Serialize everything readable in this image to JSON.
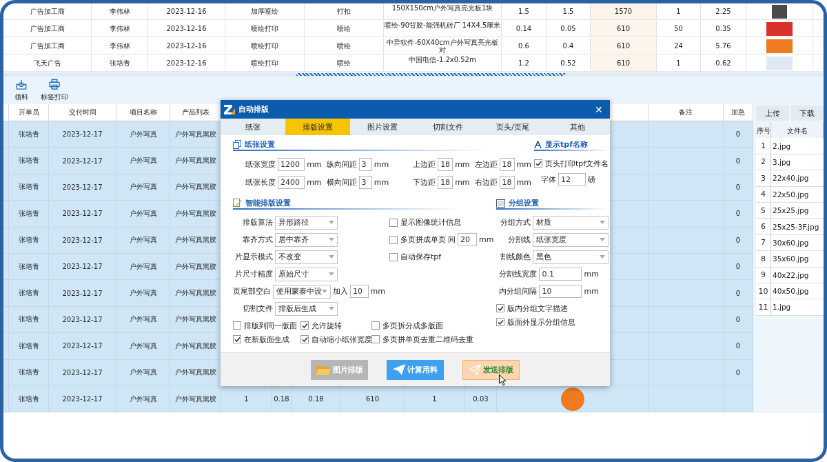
{
  "top_table": {
    "rows": [
      {
        "cells": [
          "广告加工商",
          "李伟林",
          "2023-12-16",
          "加厚喷绘",
          "打扣",
          "150X150cm户外写真亮光板1块",
          "1.5",
          "1.5",
          "1570",
          "1",
          "2.25"
        ],
        "thumbnail": true
      },
      {
        "cells": [
          "广告加工商",
          "李伟林",
          "2023-12-16",
          "喷绘打印",
          "喷绘",
          "喷绘-90背胶-能强机砖厂 14X4.5厘米",
          "0.14",
          "0.05",
          "610",
          "50",
          "0.35"
        ],
        "thumbnail": true
      },
      {
        "cells": [
          "广告加工商",
          "李伟林",
          "2023-12-16",
          "喷绘打印",
          "喷绘",
          "中异软件-60X40cm户外写真亮光板对",
          "0.6",
          "0.4",
          "610",
          "24",
          "5.76"
        ],
        "thumbnail": true
      },
      {
        "cells": [
          "飞天广告",
          "张培青",
          "2023-12-16",
          "喷绘打印",
          "喷绘",
          "中国电信-1.2x0.52m",
          "1.2",
          "0.52",
          "610",
          "1",
          "0.62"
        ],
        "thumbnail": true
      }
    ]
  },
  "toolbar": [
    {
      "label": "领料"
    },
    {
      "label": "标签打印"
    }
  ],
  "orders_table": {
    "columns": [
      "开单员",
      "交付时间",
      "项目名称",
      "产品列表"
    ],
    "trailing_columns": [
      "备注",
      "加急"
    ],
    "rows": [
      {
        "selected": true,
        "cells": [
          "张培青",
          "2023-12-17",
          "户外写真",
          "户外写真黑胶"
        ],
        "urgent": "0"
      },
      {
        "selected": true,
        "cells": [
          "张培青",
          "2023-12-17",
          "户外写真",
          "户外写真黑胶"
        ],
        "urgent": "0"
      },
      {
        "selected": true,
        "cells": [
          "张培青",
          "2023-12-17",
          "户外写真",
          "户外写真黑胶"
        ],
        "urgent": "0"
      },
      {
        "selected": true,
        "cells": [
          "张培青",
          "2023-12-17",
          "户外写真",
          "户外写真黑胶"
        ],
        "urgent": "0"
      },
      {
        "selected": true,
        "cells": [
          "张培青",
          "2023-12-17",
          "户外写真",
          "户外写真黑胶"
        ],
        "urgent": "0"
      },
      {
        "selected": true,
        "cells": [
          "张培青",
          "2023-12-17",
          "户外写真",
          "户外写真黑胶"
        ],
        "urgent": "0"
      },
      {
        "selected": true,
        "cells": [
          "张培青",
          "2023-12-17",
          "户外写真",
          "户外写真黑胶"
        ],
        "urgent": "0"
      },
      {
        "selected": true,
        "cells": [
          "张培青",
          "2023-12-17",
          "户外写真",
          "户外写真黑胶"
        ],
        "urgent": "0"
      },
      {
        "selected": true,
        "cells": [
          "张培青",
          "2023-12-17",
          "户外写真",
          "户外写真黑胶"
        ],
        "urgent": "0"
      },
      {
        "selected": true,
        "cells": [
          "张培青",
          "2023-12-17",
          "户外写真",
          "户外写真黑胶"
        ],
        "urgent": "0"
      },
      {
        "selected": true,
        "cells": [
          "张培青",
          "2023-12-17",
          "户外写真",
          "户外写真黑胶"
        ],
        "details": [
          "1",
          "0.18",
          "0.18",
          "610",
          "1",
          "0.03"
        ],
        "thumbnail": true
      }
    ]
  },
  "files_panel": {
    "buttons": [
      "上传",
      "下载"
    ],
    "columns": [
      "序号",
      "文件名"
    ],
    "rows": [
      [
        "1",
        "2.jpg"
      ],
      [
        "2",
        "3.jpg"
      ],
      [
        "3",
        "22x40.jpg"
      ],
      [
        "4",
        "22x50.jpg"
      ],
      [
        "5",
        "25x25.jpg"
      ],
      [
        "6",
        "25x25-3F.jpg"
      ],
      [
        "7",
        "30x60.jpg"
      ],
      [
        "8",
        "35x60.jpg"
      ],
      [
        "9",
        "40x22.jpg"
      ],
      [
        "10",
        "40x50.jpg"
      ],
      [
        "11",
        "1.jpg"
      ]
    ]
  },
  "dialog": {
    "title": "自动排版",
    "close": "✕",
    "tabs": [
      {
        "label": "纸张",
        "selected": false
      },
      {
        "label": "排版设置",
        "selected": true
      },
      {
        "label": "图片设置",
        "selected": false
      },
      {
        "label": "切割文件",
        "selected": false
      },
      {
        "label": "页头/页尾",
        "selected": false
      },
      {
        "label": "其他",
        "selected": false
      }
    ],
    "paper_settings": {
      "title": "纸张设置",
      "rows": [
        [
          {
            "label": "纸张宽度",
            "value": "1200",
            "unit": "mm"
          },
          {
            "label": "纵向间距",
            "value": "3",
            "unit": "mm"
          },
          {
            "label": "上边距",
            "value": "18",
            "unit": "mm"
          },
          {
            "label": "左边距",
            "value": "18",
            "unit": "mm"
          }
        ],
        [
          {
            "label": "纸张长度",
            "value": "2400",
            "unit": "mm"
          },
          {
            "label": "横向间距",
            "value": "3",
            "unit": "mm"
          },
          {
            "label": "下边距",
            "value": "18",
            "unit": "mm"
          },
          {
            "label": "右边距",
            "value": "18",
            "unit": "mm"
          }
        ]
      ]
    },
    "tpf_name": {
      "title": "显示tpf名称",
      "checkbox": {
        "label": "页头打印tpf文件名",
        "checked": true
      },
      "font": {
        "label": "字体",
        "value": "12",
        "unit": "磅"
      }
    },
    "smart_layout": {
      "title": "智能排版设置",
      "fields": [
        {
          "label": "排版算法",
          "value": "异形路径"
        },
        {
          "label": "靠齐方式",
          "value": "居中靠齐"
        },
        {
          "label": "片显示模式",
          "value": "不改变"
        },
        {
          "label": "片尺寸精度",
          "value": "原始尺寸"
        },
        {
          "label": "页尾部空白",
          "value": "使用蒙泰中设",
          "extra": {
            "label": "加入",
            "value": "10",
            "unit": "mm"
          }
        },
        {
          "label": "切割文件",
          "value": "排版后生成"
        }
      ],
      "options": [
        {
          "label": "显示图像统计信息",
          "checked": false
        },
        {
          "label": "多页拼成单页",
          "checked": false,
          "extra": {
            "label": "间",
            "value": "20",
            "unit": "mm"
          }
        },
        {
          "label": "自动保存tpf",
          "checked": false
        }
      ],
      "checkboxes": [
        {
          "label": "排版到同一版面",
          "checked": false
        },
        {
          "label": "允许旋转",
          "checked": true
        },
        {
          "label": "多页拆分成多版面",
          "checked": false
        },
        {
          "label": "在新版面生成",
          "checked": true
        },
        {
          "label": "自动缩小纸张宽度",
          "checked": true
        },
        {
          "label": "多页拼单页去重二维码去重",
          "checked": false
        }
      ]
    },
    "grouping": {
      "title": "分组设置",
      "fields": [
        {
          "kind": "select",
          "label": "分组方式",
          "value": "材质"
        },
        {
          "kind": "select",
          "label": "分割线",
          "value": "纸张宽度"
        },
        {
          "kind": "select",
          "label": "割线颜色",
          "value": "黑色"
        },
        {
          "kind": "input",
          "label": "分割线宽度",
          "value": "0.1",
          "unit": "mm"
        },
        {
          "kind": "input",
          "label": "内分组间隔",
          "value": "10",
          "unit": "mm"
        }
      ],
      "checkboxes": [
        {
          "label": "版内分组文字描述",
          "checked": true
        },
        {
          "label": "版面外显示分组信息",
          "checked": true
        }
      ]
    },
    "buttons": [
      {
        "label": "图片排版",
        "kind": "folder"
      },
      {
        "label": "计算用料",
        "kind": "primary"
      },
      {
        "label": "发送排版",
        "kind": "hover"
      }
    ]
  }
}
